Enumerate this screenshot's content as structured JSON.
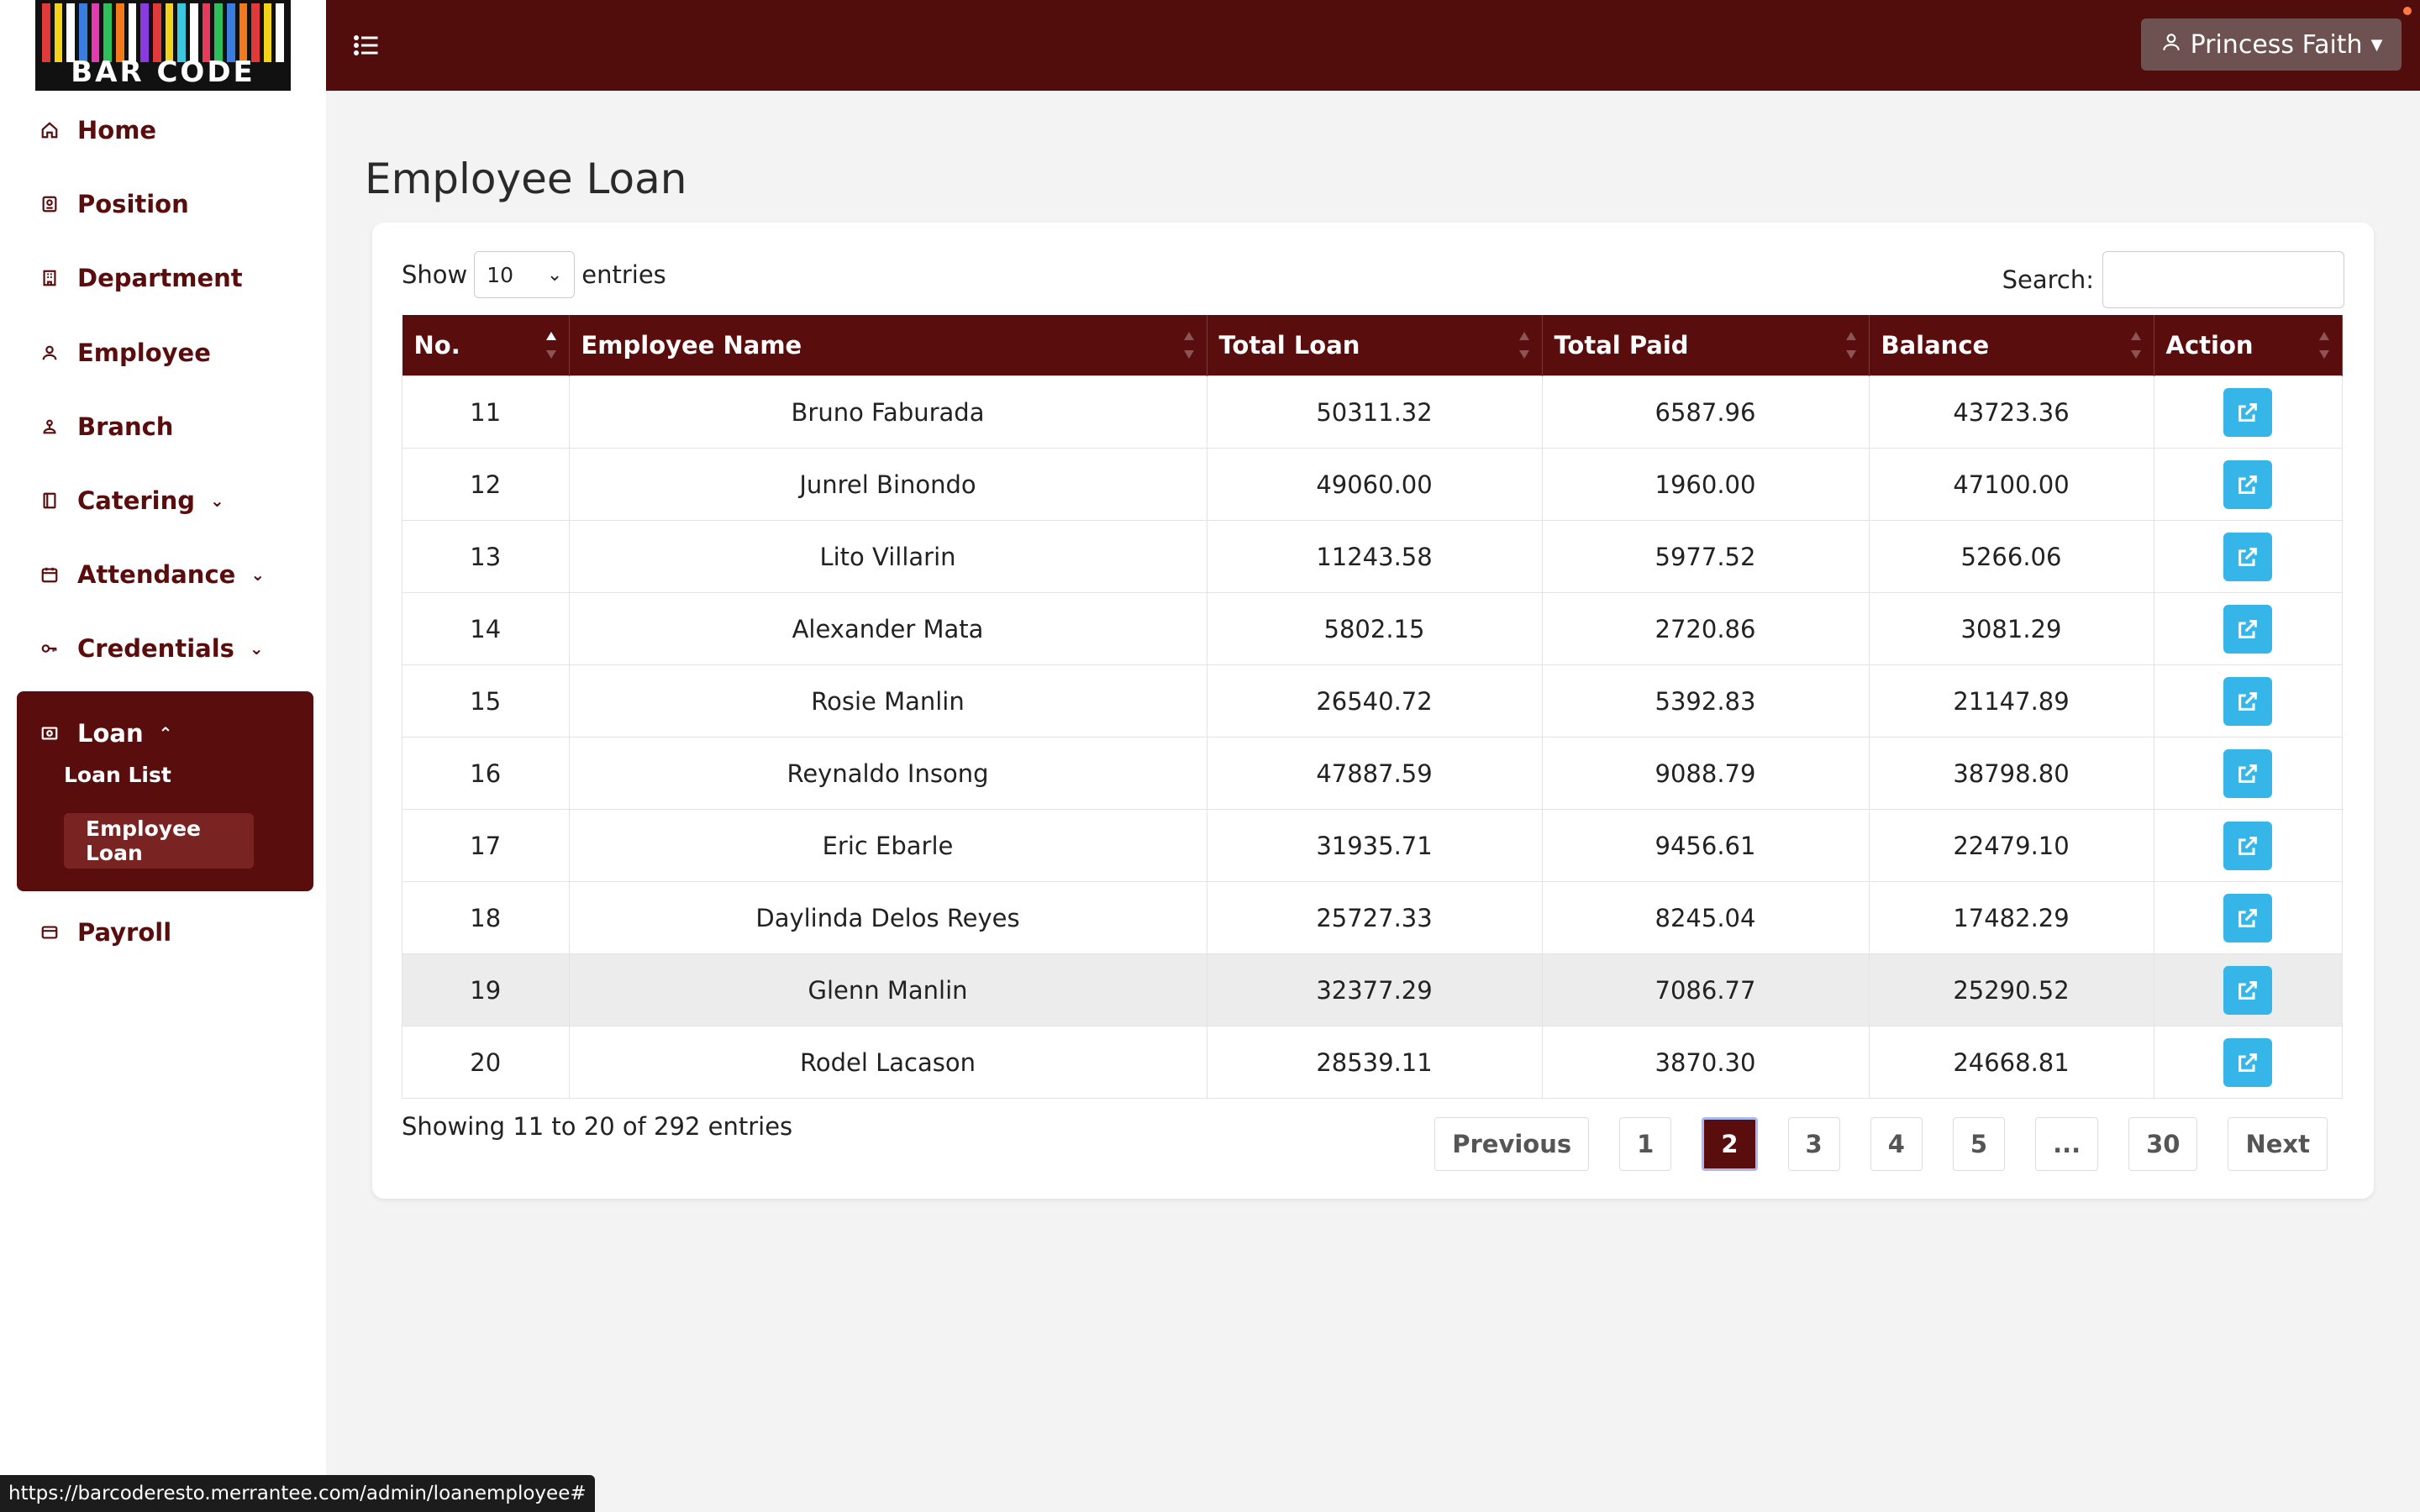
{
  "brand": {
    "logo_text": "BAR CODE"
  },
  "topbar": {
    "user_name": "Princess Faith"
  },
  "sidebar": {
    "items": [
      {
        "label": "Home",
        "icon": "home-icon"
      },
      {
        "label": "Position",
        "icon": "badge-icon"
      },
      {
        "label": "Department",
        "icon": "building-icon"
      },
      {
        "label": "Employee",
        "icon": "user-icon"
      },
      {
        "label": "Branch",
        "icon": "branch-icon"
      },
      {
        "label": "Catering",
        "icon": "book-icon",
        "expandable": true
      },
      {
        "label": "Attendance",
        "icon": "calendar-icon",
        "expandable": true
      },
      {
        "label": "Credentials",
        "icon": "key-icon",
        "expandable": true
      },
      {
        "label": "Loan",
        "icon": "cash-icon",
        "expanded": true
      },
      {
        "label": "Payroll",
        "icon": "card-icon"
      }
    ],
    "loan_sub": [
      "Loan List",
      "Employee Loan"
    ]
  },
  "page": {
    "title": "Employee Loan"
  },
  "table_controls": {
    "show_label": "Show",
    "entries_value": "10",
    "entries_label": "entries",
    "search_label": "Search:"
  },
  "table": {
    "columns": [
      "No.",
      "Employee Name",
      "Total Loan",
      "Total Paid",
      "Balance",
      "Action"
    ],
    "rows": [
      [
        "11",
        "Bruno Faburada",
        "50311.32",
        "6587.96",
        "43723.36"
      ],
      [
        "12",
        "Junrel Binondo",
        "49060.00",
        "1960.00",
        "47100.00"
      ],
      [
        "13",
        "Lito Villarin",
        "11243.58",
        "5977.52",
        "5266.06"
      ],
      [
        "14",
        "Alexander Mata",
        "5802.15",
        "2720.86",
        "3081.29"
      ],
      [
        "15",
        "Rosie Manlin",
        "26540.72",
        "5392.83",
        "21147.89"
      ],
      [
        "16",
        "Reynaldo Insong",
        "47887.59",
        "9088.79",
        "38798.80"
      ],
      [
        "17",
        "Eric Ebarle",
        "31935.71",
        "9456.61",
        "22479.10"
      ],
      [
        "18",
        "Daylinda Delos Reyes",
        "25727.33",
        "8245.04",
        "17482.29"
      ],
      [
        "19",
        "Glenn Manlin",
        "32377.29",
        "7086.77",
        "25290.52"
      ],
      [
        "20",
        "Rodel Lacason",
        "28539.11",
        "3870.30",
        "24668.81"
      ]
    ]
  },
  "footer": {
    "info": "Showing 11 to 20 of 292 entries",
    "pagination": [
      "Previous",
      "1",
      "2",
      "3",
      "4",
      "5",
      "...",
      "30",
      "Next"
    ],
    "active_page": "2"
  },
  "status_bar": {
    "url": "https://barcoderesto.merrantee.com/admin/loanemployee#"
  },
  "colors": {
    "primary": "#5a0d0d",
    "topbar": "#510c0c",
    "action": "#36b6e8"
  }
}
